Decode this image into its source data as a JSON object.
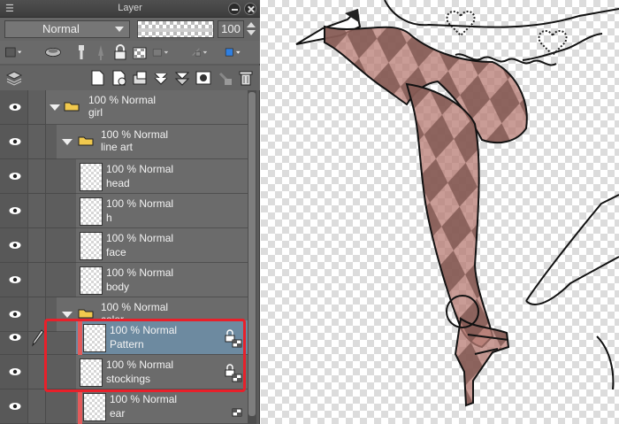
{
  "panel": {
    "title": "Layer",
    "blend_mode": "Normal",
    "opacity": "100",
    "opacity_fraction": 1.0
  },
  "layers": [
    {
      "opacity_mode": "100 % Normal",
      "name": "girl",
      "type": "folder",
      "expanded": true
    },
    {
      "opacity_mode": "100 % Normal",
      "name": "line art",
      "type": "folder",
      "expanded": true
    },
    {
      "opacity_mode": "100 % Normal",
      "name": "head",
      "type": "raster"
    },
    {
      "opacity_mode": "100 % Normal",
      "name": "h",
      "type": "raster"
    },
    {
      "opacity_mode": "100 % Normal",
      "name": "face",
      "type": "raster"
    },
    {
      "opacity_mode": "100 % Normal",
      "name": "body",
      "type": "raster"
    },
    {
      "opacity_mode": "100 % Normal",
      "name": "color",
      "type": "folder",
      "expanded": true
    },
    {
      "opacity_mode": "100 % Normal",
      "name": "Pattern",
      "type": "raster",
      "selected": true,
      "clipped": true
    },
    {
      "opacity_mode": "100 % Normal",
      "name": "stockings",
      "type": "raster"
    },
    {
      "opacity_mode": "100 % Normal",
      "name": "ear",
      "type": "raster",
      "clipped": true
    }
  ],
  "colors": {
    "highlight": "#e8202a",
    "selected_row": "#6d8aa0",
    "clipping_bar": "#e35b5b",
    "pattern_tint": "#a05a52"
  }
}
